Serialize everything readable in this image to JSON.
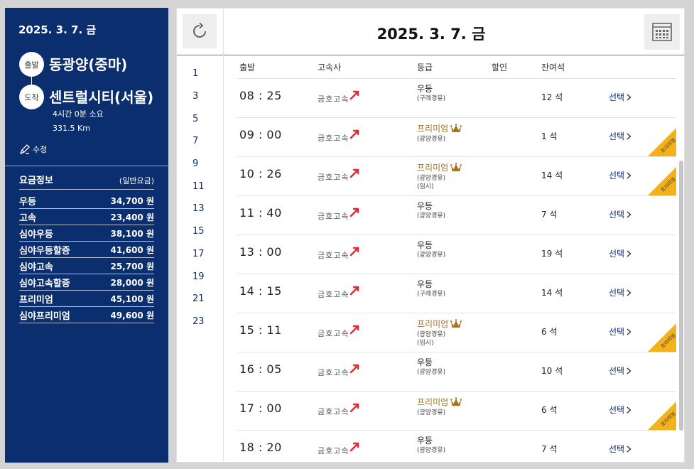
{
  "sidebar": {
    "date": "2025. 3. 7. 금",
    "departure_badge": "출발",
    "arrival_badge": "도착",
    "departure": "동광양(중마)",
    "arrival": "센트럴시티(서울)",
    "duration": "4시간 0분 소요",
    "distance": "331.5 Km",
    "edit_label": "수정",
    "fare_title": "요금정보",
    "fare_subtitle": "(일반요금)",
    "fares": [
      {
        "name": "우등",
        "price": "34,700 원"
      },
      {
        "name": "고속",
        "price": "23,400 원"
      },
      {
        "name": "심야우등",
        "price": "38,100 원"
      },
      {
        "name": "심야우등할증",
        "price": "41,600 원"
      },
      {
        "name": "심야고속",
        "price": "25,700 원"
      },
      {
        "name": "심야고속할증",
        "price": "28,000 원"
      },
      {
        "name": "프리미엄",
        "price": "45,100 원"
      },
      {
        "name": "심야프리미엄",
        "price": "49,600 원"
      }
    ]
  },
  "header": {
    "date": "2025. 3. 7. 금",
    "refresh_icon": "refresh-icon",
    "calendar_icon": "calendar-icon"
  },
  "hours": [
    "1",
    "3",
    "5",
    "7",
    "9",
    "11",
    "13",
    "15",
    "17",
    "19",
    "21",
    "23"
  ],
  "columns": {
    "depart": "출발",
    "company": "고속사",
    "grade": "등급",
    "discount": "할인",
    "seats": "잔여석"
  },
  "colors": {
    "navy": "#0b2e6f",
    "premium": "#a7731e",
    "ribbon": "#f3b21a",
    "logo_red": "#e8262f"
  },
  "rows": [
    {
      "time": "08 : 25",
      "company": "금호고속",
      "grade": "우등",
      "premium": false,
      "via": "(구례경유)",
      "temp": "",
      "seats": "12 석",
      "select": "선택"
    },
    {
      "time": "09 : 00",
      "company": "금호고속",
      "grade": "프리미엄",
      "premium": true,
      "via": "(광양경유)",
      "temp": "",
      "seats": "1 석",
      "select": "선택",
      "ribbon": "프리미엄"
    },
    {
      "time": "10 : 26",
      "company": "금호고속",
      "grade": "프리미엄",
      "premium": true,
      "via": "(광양경유)",
      "temp": "(임시)",
      "seats": "14 석",
      "select": "선택",
      "ribbon": "프리미엄"
    },
    {
      "time": "11 : 40",
      "company": "금호고속",
      "grade": "우등",
      "premium": false,
      "via": "(광양경유)",
      "temp": "",
      "seats": "7 석",
      "select": "선택"
    },
    {
      "time": "13 : 00",
      "company": "금호고속",
      "grade": "우등",
      "premium": false,
      "via": "(광양경유)",
      "temp": "",
      "seats": "19 석",
      "select": "선택"
    },
    {
      "time": "14 : 15",
      "company": "금호고속",
      "grade": "우등",
      "premium": false,
      "via": "(구례경유)",
      "temp": "",
      "seats": "14 석",
      "select": "선택"
    },
    {
      "time": "15 : 11",
      "company": "금호고속",
      "grade": "프리미엄",
      "premium": true,
      "via": "(광양경유)",
      "temp": "(임시)",
      "seats": "6 석",
      "select": "선택",
      "ribbon": "프리미엄"
    },
    {
      "time": "16 : 05",
      "company": "금호고속",
      "grade": "우등",
      "premium": false,
      "via": "(광양경유)",
      "temp": "",
      "seats": "10 석",
      "select": "선택"
    },
    {
      "time": "17 : 00",
      "company": "금호고속",
      "grade": "프리미엄",
      "premium": true,
      "via": "(광양경유)",
      "temp": "",
      "seats": "6 석",
      "select": "선택",
      "ribbon": "프리미엄"
    },
    {
      "time": "18 : 20",
      "company": "금호고속",
      "grade": "우등",
      "premium": false,
      "via": "(광양경유)",
      "temp": "",
      "seats": "7 석",
      "select": "선택"
    }
  ]
}
